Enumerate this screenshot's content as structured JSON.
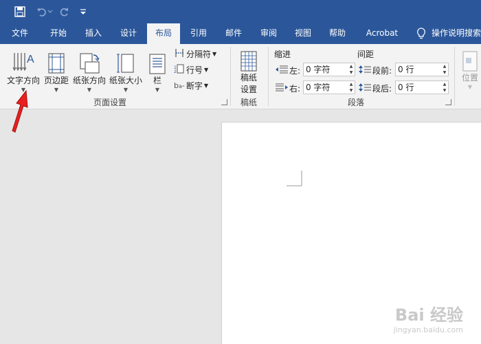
{
  "quick_access": {
    "save_icon": "save-icon",
    "undo_icon": "undo-icon",
    "redo_icon": "redo-icon",
    "customize_icon": "customize-qat-icon"
  },
  "tabs": [
    {
      "label": "文件",
      "active": false
    },
    {
      "label": "开始",
      "active": false
    },
    {
      "label": "插入",
      "active": false
    },
    {
      "label": "设计",
      "active": false
    },
    {
      "label": "布局",
      "active": true
    },
    {
      "label": "引用",
      "active": false
    },
    {
      "label": "邮件",
      "active": false
    },
    {
      "label": "审阅",
      "active": false
    },
    {
      "label": "视图",
      "active": false
    },
    {
      "label": "帮助",
      "active": false
    },
    {
      "label": "Acrobat",
      "active": false
    }
  ],
  "tell_me": {
    "icon": "lightbulb-icon",
    "label": "操作说明搜索"
  },
  "ribbon": {
    "page_setup": {
      "text_direction": "文字方向",
      "margins": "页边距",
      "orientation": "纸张方向",
      "size": "纸张大小",
      "columns": "栏",
      "breaks": "分隔符",
      "line_numbers": "行号",
      "hyphenation": "断字",
      "group_label": "页面设置"
    },
    "manuscript": {
      "button_line1": "稿纸",
      "button_line2": "设置",
      "group_label": "稿纸"
    },
    "paragraph": {
      "indent_header": "缩进",
      "spacing_header": "间距",
      "left_label": "左:",
      "left_value": "0 字符",
      "right_label": "右:",
      "right_value": "0 字符",
      "before_label": "段前:",
      "before_value": "0 行",
      "after_label": "段后:",
      "after_value": "0 行",
      "group_label": "段落"
    },
    "arrange": {
      "position": "位置"
    }
  },
  "watermark": {
    "main": "Bai 经验",
    "sub": "jingyan.baidu.com"
  },
  "colors": {
    "title_bar": "#2b579a",
    "ribbon": "#f3f3f3",
    "annotation_arrow": "#e8201e"
  }
}
